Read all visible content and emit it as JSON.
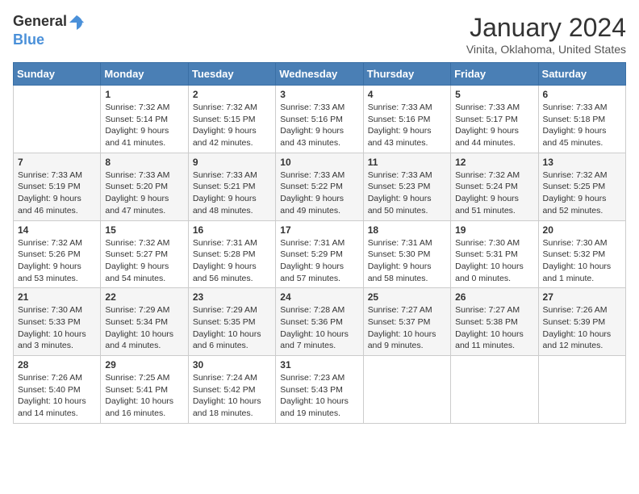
{
  "logo": {
    "text_general": "General",
    "text_blue": "Blue"
  },
  "header": {
    "month_title": "January 2024",
    "location": "Vinita, Oklahoma, United States"
  },
  "weekdays": [
    "Sunday",
    "Monday",
    "Tuesday",
    "Wednesday",
    "Thursday",
    "Friday",
    "Saturday"
  ],
  "weeks": [
    [
      {
        "day": "",
        "sunrise": "",
        "sunset": "",
        "daylight": ""
      },
      {
        "day": "1",
        "sunrise": "Sunrise: 7:32 AM",
        "sunset": "Sunset: 5:14 PM",
        "daylight": "Daylight: 9 hours and 41 minutes."
      },
      {
        "day": "2",
        "sunrise": "Sunrise: 7:32 AM",
        "sunset": "Sunset: 5:15 PM",
        "daylight": "Daylight: 9 hours and 42 minutes."
      },
      {
        "day": "3",
        "sunrise": "Sunrise: 7:33 AM",
        "sunset": "Sunset: 5:16 PM",
        "daylight": "Daylight: 9 hours and 43 minutes."
      },
      {
        "day": "4",
        "sunrise": "Sunrise: 7:33 AM",
        "sunset": "Sunset: 5:16 PM",
        "daylight": "Daylight: 9 hours and 43 minutes."
      },
      {
        "day": "5",
        "sunrise": "Sunrise: 7:33 AM",
        "sunset": "Sunset: 5:17 PM",
        "daylight": "Daylight: 9 hours and 44 minutes."
      },
      {
        "day": "6",
        "sunrise": "Sunrise: 7:33 AM",
        "sunset": "Sunset: 5:18 PM",
        "daylight": "Daylight: 9 hours and 45 minutes."
      }
    ],
    [
      {
        "day": "7",
        "sunrise": "Sunrise: 7:33 AM",
        "sunset": "Sunset: 5:19 PM",
        "daylight": "Daylight: 9 hours and 46 minutes."
      },
      {
        "day": "8",
        "sunrise": "Sunrise: 7:33 AM",
        "sunset": "Sunset: 5:20 PM",
        "daylight": "Daylight: 9 hours and 47 minutes."
      },
      {
        "day": "9",
        "sunrise": "Sunrise: 7:33 AM",
        "sunset": "Sunset: 5:21 PM",
        "daylight": "Daylight: 9 hours and 48 minutes."
      },
      {
        "day": "10",
        "sunrise": "Sunrise: 7:33 AM",
        "sunset": "Sunset: 5:22 PM",
        "daylight": "Daylight: 9 hours and 49 minutes."
      },
      {
        "day": "11",
        "sunrise": "Sunrise: 7:33 AM",
        "sunset": "Sunset: 5:23 PM",
        "daylight": "Daylight: 9 hours and 50 minutes."
      },
      {
        "day": "12",
        "sunrise": "Sunrise: 7:32 AM",
        "sunset": "Sunset: 5:24 PM",
        "daylight": "Daylight: 9 hours and 51 minutes."
      },
      {
        "day": "13",
        "sunrise": "Sunrise: 7:32 AM",
        "sunset": "Sunset: 5:25 PM",
        "daylight": "Daylight: 9 hours and 52 minutes."
      }
    ],
    [
      {
        "day": "14",
        "sunrise": "Sunrise: 7:32 AM",
        "sunset": "Sunset: 5:26 PM",
        "daylight": "Daylight: 9 hours and 53 minutes."
      },
      {
        "day": "15",
        "sunrise": "Sunrise: 7:32 AM",
        "sunset": "Sunset: 5:27 PM",
        "daylight": "Daylight: 9 hours and 54 minutes."
      },
      {
        "day": "16",
        "sunrise": "Sunrise: 7:31 AM",
        "sunset": "Sunset: 5:28 PM",
        "daylight": "Daylight: 9 hours and 56 minutes."
      },
      {
        "day": "17",
        "sunrise": "Sunrise: 7:31 AM",
        "sunset": "Sunset: 5:29 PM",
        "daylight": "Daylight: 9 hours and 57 minutes."
      },
      {
        "day": "18",
        "sunrise": "Sunrise: 7:31 AM",
        "sunset": "Sunset: 5:30 PM",
        "daylight": "Daylight: 9 hours and 58 minutes."
      },
      {
        "day": "19",
        "sunrise": "Sunrise: 7:30 AM",
        "sunset": "Sunset: 5:31 PM",
        "daylight": "Daylight: 10 hours and 0 minutes."
      },
      {
        "day": "20",
        "sunrise": "Sunrise: 7:30 AM",
        "sunset": "Sunset: 5:32 PM",
        "daylight": "Daylight: 10 hours and 1 minute."
      }
    ],
    [
      {
        "day": "21",
        "sunrise": "Sunrise: 7:30 AM",
        "sunset": "Sunset: 5:33 PM",
        "daylight": "Daylight: 10 hours and 3 minutes."
      },
      {
        "day": "22",
        "sunrise": "Sunrise: 7:29 AM",
        "sunset": "Sunset: 5:34 PM",
        "daylight": "Daylight: 10 hours and 4 minutes."
      },
      {
        "day": "23",
        "sunrise": "Sunrise: 7:29 AM",
        "sunset": "Sunset: 5:35 PM",
        "daylight": "Daylight: 10 hours and 6 minutes."
      },
      {
        "day": "24",
        "sunrise": "Sunrise: 7:28 AM",
        "sunset": "Sunset: 5:36 PM",
        "daylight": "Daylight: 10 hours and 7 minutes."
      },
      {
        "day": "25",
        "sunrise": "Sunrise: 7:27 AM",
        "sunset": "Sunset: 5:37 PM",
        "daylight": "Daylight: 10 hours and 9 minutes."
      },
      {
        "day": "26",
        "sunrise": "Sunrise: 7:27 AM",
        "sunset": "Sunset: 5:38 PM",
        "daylight": "Daylight: 10 hours and 11 minutes."
      },
      {
        "day": "27",
        "sunrise": "Sunrise: 7:26 AM",
        "sunset": "Sunset: 5:39 PM",
        "daylight": "Daylight: 10 hours and 12 minutes."
      }
    ],
    [
      {
        "day": "28",
        "sunrise": "Sunrise: 7:26 AM",
        "sunset": "Sunset: 5:40 PM",
        "daylight": "Daylight: 10 hours and 14 minutes."
      },
      {
        "day": "29",
        "sunrise": "Sunrise: 7:25 AM",
        "sunset": "Sunset: 5:41 PM",
        "daylight": "Daylight: 10 hours and 16 minutes."
      },
      {
        "day": "30",
        "sunrise": "Sunrise: 7:24 AM",
        "sunset": "Sunset: 5:42 PM",
        "daylight": "Daylight: 10 hours and 18 minutes."
      },
      {
        "day": "31",
        "sunrise": "Sunrise: 7:23 AM",
        "sunset": "Sunset: 5:43 PM",
        "daylight": "Daylight: 10 hours and 19 minutes."
      },
      {
        "day": "",
        "sunrise": "",
        "sunset": "",
        "daylight": ""
      },
      {
        "day": "",
        "sunrise": "",
        "sunset": "",
        "daylight": ""
      },
      {
        "day": "",
        "sunrise": "",
        "sunset": "",
        "daylight": ""
      }
    ]
  ]
}
